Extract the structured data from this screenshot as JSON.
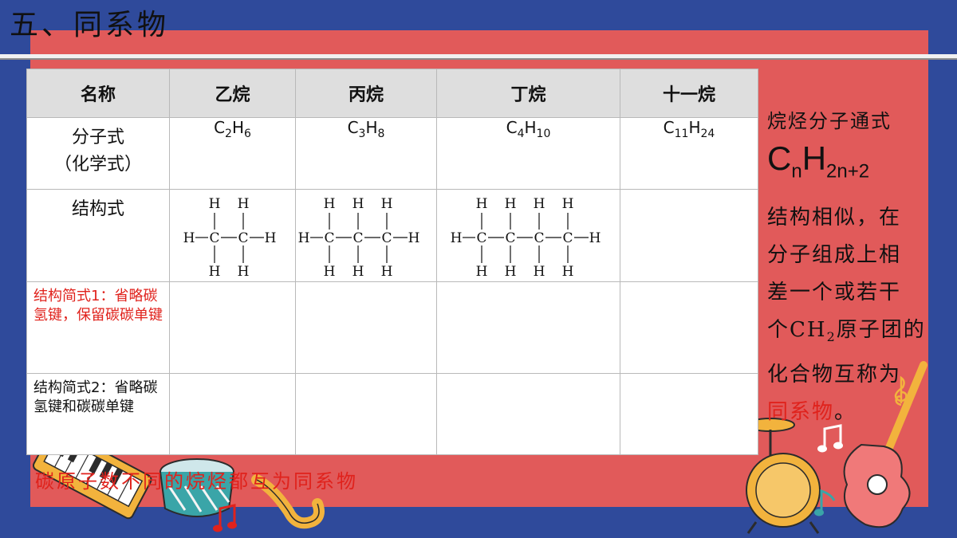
{
  "title": "五、同系物",
  "table": {
    "headers": [
      "名称",
      "乙烷",
      "丙烷",
      "丁烷",
      "十一烷"
    ],
    "row_molecular": {
      "label_line1": "分子式",
      "label_line2": "（化学式）",
      "formulas": [
        {
          "c": "C",
          "cn": "2",
          "h": "H",
          "hn": "6"
        },
        {
          "c": "C",
          "cn": "3",
          "h": "H",
          "hn": "8"
        },
        {
          "c": "C",
          "cn": "4",
          "h": "H",
          "hn": "10"
        },
        {
          "c": "C",
          "cn": "11",
          "h": "H",
          "hn": "24"
        }
      ]
    },
    "row_structural": {
      "label": "结构式",
      "atom_c": "C",
      "atom_h": "H"
    },
    "row_simple1": {
      "label": "结构简式1：省略碳氢键，保留碳碳单键"
    },
    "row_simple2": {
      "label": "结构简式2：省略碳氢键和碳碳单键"
    }
  },
  "side": {
    "general_label": "烷烃分子通式",
    "general_c": "C",
    "general_cn": "n",
    "general_h": "H",
    "general_hn": "2n+2",
    "desc_lines": [
      "结构相似，在",
      "分子组成上相",
      "差一个或若干"
    ],
    "desc_line4_pre": "个CH",
    "desc_line4_sub": "2",
    "desc_line4_post": "原子团的",
    "desc_line5": "化合物互称为",
    "desc_term": "同系物",
    "desc_end": "。"
  },
  "bottom_note": "碳原子数不同的烷烃都互为同系物",
  "colors": {
    "background": "#2f4a9b",
    "panel": "#e15a5a",
    "highlight_red": "#e0221c",
    "header_gray": "#dedede"
  }
}
